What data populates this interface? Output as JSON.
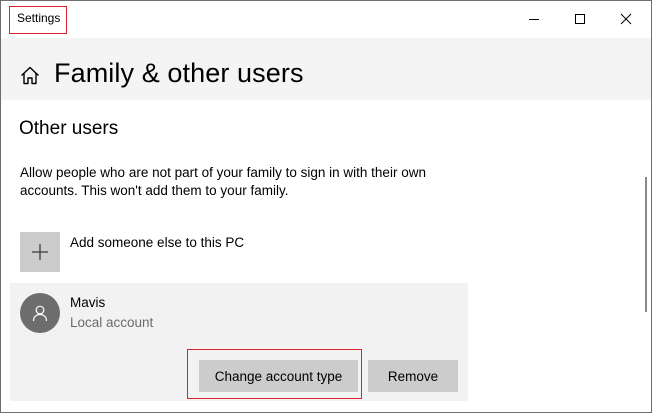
{
  "window": {
    "title": "Settings",
    "controls": {
      "minimize_icon": "minimize-icon",
      "maximize_icon": "maximize-icon",
      "close_icon": "close-icon"
    }
  },
  "header": {
    "home_icon": "home-icon",
    "title": "Family & other users"
  },
  "section": {
    "title": "Other users",
    "description": "Allow people who are not part of your family to sign in with their own accounts. This won't add them to your family."
  },
  "add_user": {
    "icon": "plus-icon",
    "label": "Add someone else to this PC"
  },
  "user": {
    "name": "Mavis",
    "account_type": "Local account",
    "avatar_icon": "person-icon",
    "change_button": "Change account type",
    "remove_button": "Remove"
  },
  "colors": {
    "highlight": "#d9232d",
    "header_bg": "#f4f4f4",
    "card_bg": "#f2f2f2",
    "button_bg": "#cccccc",
    "avatar_bg": "#6d6d6d",
    "secondary_text": "#6b6b6b"
  }
}
